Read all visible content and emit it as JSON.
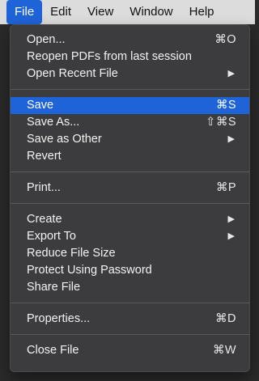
{
  "menubar": {
    "items": [
      {
        "label": "File",
        "active": true
      },
      {
        "label": "Edit"
      },
      {
        "label": "View"
      },
      {
        "label": "Window"
      },
      {
        "label": "Help"
      }
    ]
  },
  "menu": {
    "groups": [
      [
        {
          "label": "Open...",
          "shortcut": "⌘O"
        },
        {
          "label": "Reopen PDFs from last session"
        },
        {
          "label": "Open Recent File",
          "submenu": true
        }
      ],
      [
        {
          "label": "Save",
          "shortcut": "⌘S",
          "highlighted": true
        },
        {
          "label": "Save As...",
          "shortcut": "⇧⌘S"
        },
        {
          "label": "Save as Other",
          "submenu": true
        },
        {
          "label": "Revert"
        }
      ],
      [
        {
          "label": "Print...",
          "shortcut": "⌘P"
        }
      ],
      [
        {
          "label": "Create",
          "submenu": true
        },
        {
          "label": "Export To",
          "submenu": true
        },
        {
          "label": "Reduce File Size"
        },
        {
          "label": "Protect Using Password"
        },
        {
          "label": "Share File"
        }
      ],
      [
        {
          "label": "Properties...",
          "shortcut": "⌘D"
        }
      ],
      [
        {
          "label": "Close File",
          "shortcut": "⌘W"
        }
      ]
    ],
    "submenu_arrow": "▶"
  },
  "colors": {
    "accent": "#1f63d8",
    "menu_bg": "#3c3c3e",
    "menubar_bg": "#dcdcdc"
  }
}
